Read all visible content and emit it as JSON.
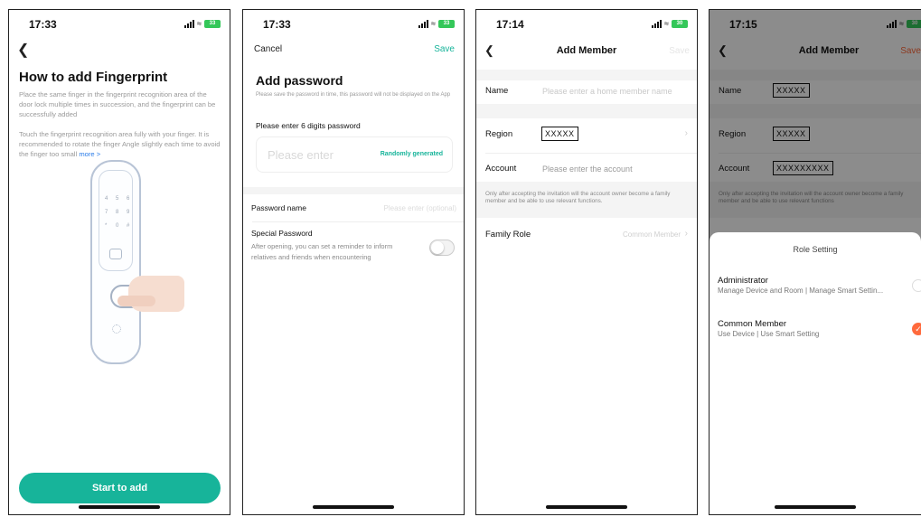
{
  "screen1": {
    "time": "17:33",
    "battery": "33",
    "back_icon": "chevron-left",
    "title": "How to add Fingerprint",
    "para1": "Place the same finger in the fingerprint recognition area of the door lock multiple times in succession, and the fingerprint can be successfully added",
    "para2": "Touch the fingerprint recognition area fully with your finger. It is recommended to rotate the finger Angle slightly each time to avoid the finger",
    "para2_tail": "too small",
    "more_link": "more >",
    "keypad": [
      "4",
      "5",
      "6",
      "7",
      "8",
      "9",
      "*",
      "0",
      "#"
    ],
    "start_button": "Start to add",
    "accent": "#17b49a"
  },
  "screen2": {
    "time": "17:33",
    "battery": "33",
    "cancel": "Cancel",
    "save": "Save",
    "title": "Add password",
    "subtitle": "Please save the password in time, this password will not be displayed on the App",
    "digits_label": "Please enter 6 digits password",
    "password_placeholder": "Please enter",
    "randomly_generated": "Randomly generated",
    "password_name_label": "Password name",
    "password_name_placeholder": "Please enter (optional)",
    "special_label": "Special Password",
    "special_desc": "After opening, you can set a reminder to inform relatives and friends when encountering",
    "special_enabled": false
  },
  "screen3": {
    "time": "17:14",
    "battery": "30",
    "title": "Add Member",
    "save": "Save",
    "name_label": "Name",
    "name_placeholder": "Please enter a home member name",
    "region_label": "Region",
    "region_value": "XXXXX",
    "account_label": "Account",
    "account_placeholder": "Please enter the account",
    "note": "Only after accepting the invitation will the account owner become a family member and be able to use relevant functions.",
    "role_label": "Family Role",
    "role_value": "Common Member"
  },
  "screen4": {
    "time": "17:15",
    "battery": "30",
    "title": "Add Member",
    "save": "Save",
    "name_label": "Name",
    "name_value": "XXXXX",
    "region_label": "Region",
    "region_value": "XXXXX",
    "account_label": "Account",
    "account_value": "XXXXXXXXX",
    "note": "Only after accepting the invitation will the account owner become a family member and be able to use relevant functions",
    "sheet_title": "Role Setting",
    "admin_title": "Administrator",
    "admin_desc": "Manage Device and Room | Manage Smart Settin...",
    "member_title": "Common Member",
    "member_desc": "Use Device | Use Smart Setting",
    "selected": "Common Member",
    "accent": "#ff6a3d"
  }
}
